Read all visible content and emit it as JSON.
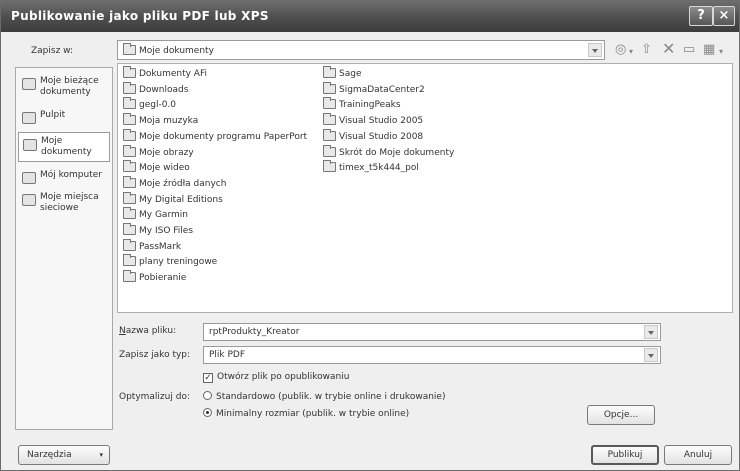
{
  "window": {
    "title": "Publikowanie jako pliku PDF lub XPS",
    "help_glyph": "?",
    "close_glyph": "×"
  },
  "save_in": {
    "label": "Zapisz w:",
    "value": "Moje dokumenty"
  },
  "places": [
    {
      "label": "Moje bieżące dokumenty",
      "icon": "recent-documents-icon"
    },
    {
      "label": "Pulpit",
      "icon": "desktop-icon"
    },
    {
      "label": "Moje dokumenty",
      "icon": "my-documents-icon"
    },
    {
      "label": "Mój komputer",
      "icon": "my-computer-icon"
    },
    {
      "label": "Moje miejsca sieciowe",
      "icon": "network-places-icon"
    }
  ],
  "files_col1": [
    "Dokumenty AFi",
    "Downloads",
    "gegl-0.0",
    "Moja muzyka",
    "Moje dokumenty programu PaperPort",
    "Moje obrazy",
    "Moje wideo",
    "Moje źródła danych",
    "My Digital Editions",
    "My Garmin",
    "My ISO Files",
    "PassMark",
    "plany treningowe",
    "Pobieranie"
  ],
  "files_col2": [
    "Sage",
    "SigmaDataCenter2",
    "TrainingPeaks",
    "Visual Studio 2005",
    "Visual Studio 2008",
    "Skrót do Moje dokumenty",
    "timex_t5k444_pol"
  ],
  "file_name": {
    "label": "Nazwa pliku:",
    "value": "rptProdukty_Kreator"
  },
  "save_type": {
    "label": "Zapisz jako typ:",
    "value": "Plik PDF"
  },
  "open_after": {
    "label": "Otwórz plik po opublikowaniu",
    "checked": true
  },
  "optimize": {
    "label": "Optymalizuj do:",
    "options": [
      {
        "label": "Standardowo (publik. w trybie online i drukowanie)",
        "selected": false
      },
      {
        "label": "Minimalny rozmiar (publik. w trybie online)",
        "selected": true
      }
    ]
  },
  "buttons": {
    "options": "Opcje...",
    "tools": "Narzędzia",
    "publish": "Publikuj",
    "cancel": "Anuluj"
  },
  "check_glyph": "✓"
}
